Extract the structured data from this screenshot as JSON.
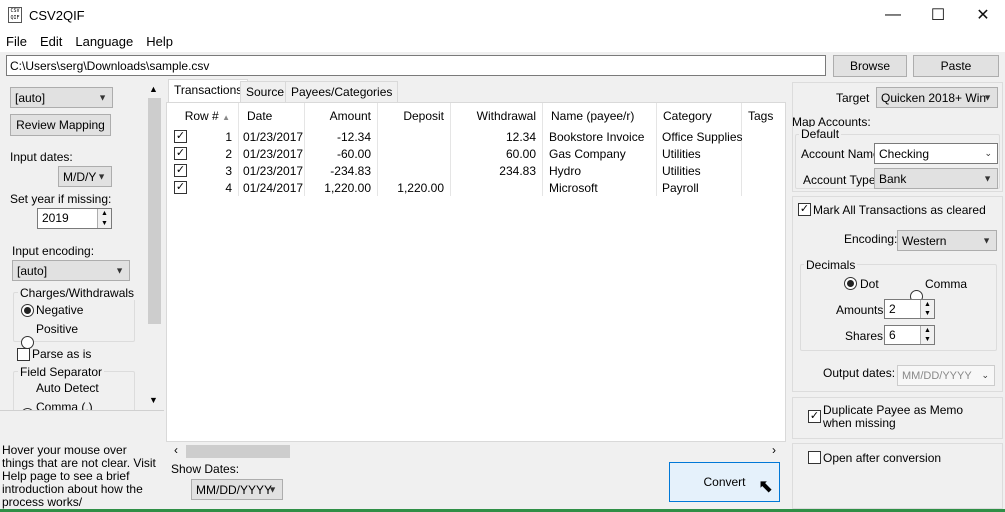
{
  "window": {
    "title": "CSV2QIF",
    "icon_text_top": "CSV",
    "icon_text_bottom": "QIF",
    "minimize": "—",
    "maximize": "☐",
    "close": "✕"
  },
  "menu": [
    "File",
    "Edit",
    "Language",
    "Help"
  ],
  "file_path": "C:\\Users\\serg\\Downloads\\sample.csv",
  "buttons": {
    "browse": "Browse",
    "paste": "Paste",
    "review_mapping": "Review Mapping",
    "convert": "Convert"
  },
  "left": {
    "mapping_select": "[auto]",
    "input_dates_label": "Input dates:",
    "input_dates_value": "M/D/Y",
    "set_year_label": "Set year if missing:",
    "year_value": "2019",
    "input_encoding_label": "Input encoding:",
    "input_encoding_value": "[auto]",
    "charges_group": "Charges/Withdrawals",
    "charges_negative": "Negative",
    "charges_positive": "Positive",
    "parse_as_is": "Parse as is",
    "field_separator": "Field Separator",
    "sep_auto": "Auto Detect",
    "sep_comma": "Comma (,)",
    "help_text": "Hover your mouse over things that are not clear. Visit Help page to see a brief introduction about how the process works/"
  },
  "tabs": [
    "Transactions",
    "Source",
    "Payees/Categories"
  ],
  "table": {
    "headers": [
      "Row #",
      "Date",
      "Amount",
      "Deposit",
      "Withdrawal",
      "Name (payee/r)",
      "Category",
      "Tags"
    ],
    "rows": [
      {
        "checked": "✓",
        "row": "1",
        "date": "01/23/2017",
        "amount": "-12.34",
        "deposit": "",
        "withdrawal": "12.34",
        "name": "Bookstore Invoice",
        "category": "Office Supplies",
        "tags": ""
      },
      {
        "checked": "✓",
        "row": "2",
        "date": "01/23/2017",
        "amount": "-60.00",
        "deposit": "",
        "withdrawal": "60.00",
        "name": "Gas Company",
        "category": "Utilities",
        "tags": ""
      },
      {
        "checked": "✓",
        "row": "3",
        "date": "01/23/2017",
        "amount": "-234.83",
        "deposit": "",
        "withdrawal": "234.83",
        "name": "Hydro",
        "category": "Utilities",
        "tags": ""
      },
      {
        "checked": "✓",
        "row": "4",
        "date": "01/24/2017",
        "amount": "1,220.00",
        "deposit": "1,220.00",
        "withdrawal": "",
        "name": "Microsoft",
        "category": "Payroll",
        "tags": ""
      }
    ]
  },
  "show_dates_label": "Show Dates:",
  "show_dates_value": "MM/DD/YYYY",
  "right": {
    "target_label": "Target",
    "target_value": "Quicken 2018+ Win",
    "map_accounts_label": "Map Accounts:",
    "default_label": "Default",
    "account_name_label": "Account Name:",
    "account_name_value": "Checking",
    "account_type_label": "Account Type:",
    "account_type_value": "Bank",
    "mark_cleared": "Mark All Transactions as cleared",
    "encoding_label": "Encoding:",
    "encoding_value": "Western",
    "decimals_label": "Decimals",
    "dot_label": "Dot",
    "comma_label": "Comma",
    "amounts_label": "Amounts",
    "amounts_value": "2",
    "shares_label": "Shares",
    "shares_value": "6",
    "output_dates_label": "Output dates:",
    "output_dates_value": "MM/DD/YYYY",
    "dup_payee": "Duplicate Payee as Memo when missing",
    "open_after": "Open after conversion"
  }
}
